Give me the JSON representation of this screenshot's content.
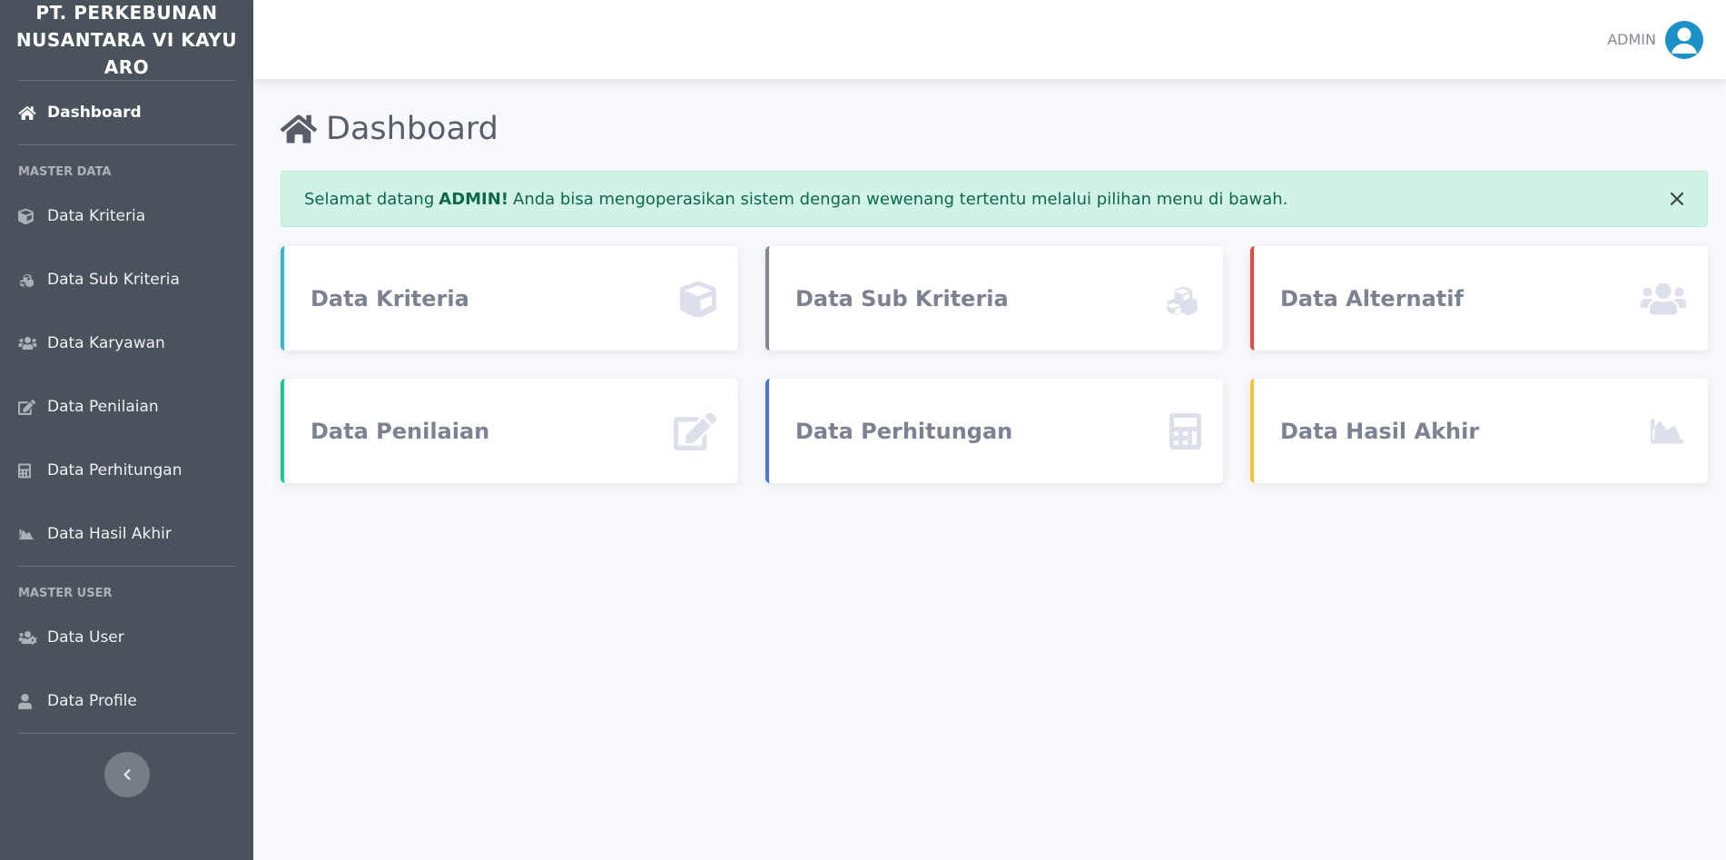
{
  "sidebar": {
    "brand": "PT. PERKEBUNAN NUSANTARA VI KAYU ARO",
    "active_item": {
      "label": "Dashboard",
      "icon": "home-icon"
    },
    "sections": [
      {
        "heading": "MASTER DATA",
        "items": [
          {
            "label": "Data Kriteria",
            "icon": "cube-icon"
          },
          {
            "label": "Data Sub Kriteria",
            "icon": "cubes-icon"
          },
          {
            "label": "Data Karyawan",
            "icon": "users-icon"
          },
          {
            "label": "Data Penilaian",
            "icon": "edit-icon"
          },
          {
            "label": "Data Perhitungan",
            "icon": "calculator-icon"
          },
          {
            "label": "Data Hasil Akhir",
            "icon": "area-chart-icon"
          }
        ]
      },
      {
        "heading": "MASTER USER",
        "items": [
          {
            "label": "Data User",
            "icon": "users-cog-icon"
          },
          {
            "label": "Data Profile",
            "icon": "user-icon"
          }
        ]
      }
    ],
    "toggle_icon": "chevron-left-icon"
  },
  "topbar": {
    "user_name": "ADMIN",
    "avatar_icon": "user-icon",
    "avatar_color": "#1b91c7"
  },
  "main": {
    "title": "Dashboard",
    "title_icon": "home-icon",
    "alert": {
      "prefix": "Selamat datang",
      "strong": "ADMIN!",
      "suffix": "Anda bisa mengoperasikan sistem dengan wewenang tertentu melalui pilihan menu di bawah.",
      "close_icon": "close-icon"
    },
    "cards": [
      {
        "label": "Data Kriteria",
        "icon": "cube-icon",
        "accent": "#36b9cc"
      },
      {
        "label": "Data Sub Kriteria",
        "icon": "cubes-icon",
        "accent": "#858796"
      },
      {
        "label": "Data Alternatif",
        "icon": "users-icon",
        "accent": "#e74a3b"
      },
      {
        "label": "Data Penilaian",
        "icon": "edit-icon",
        "accent": "#1cc88a"
      },
      {
        "label": "Data Perhitungan",
        "icon": "calculator-icon",
        "accent": "#4e73df"
      },
      {
        "label": "Data Hasil Akhir",
        "icon": "area-chart-icon",
        "accent": "#f6c23e"
      }
    ]
  }
}
